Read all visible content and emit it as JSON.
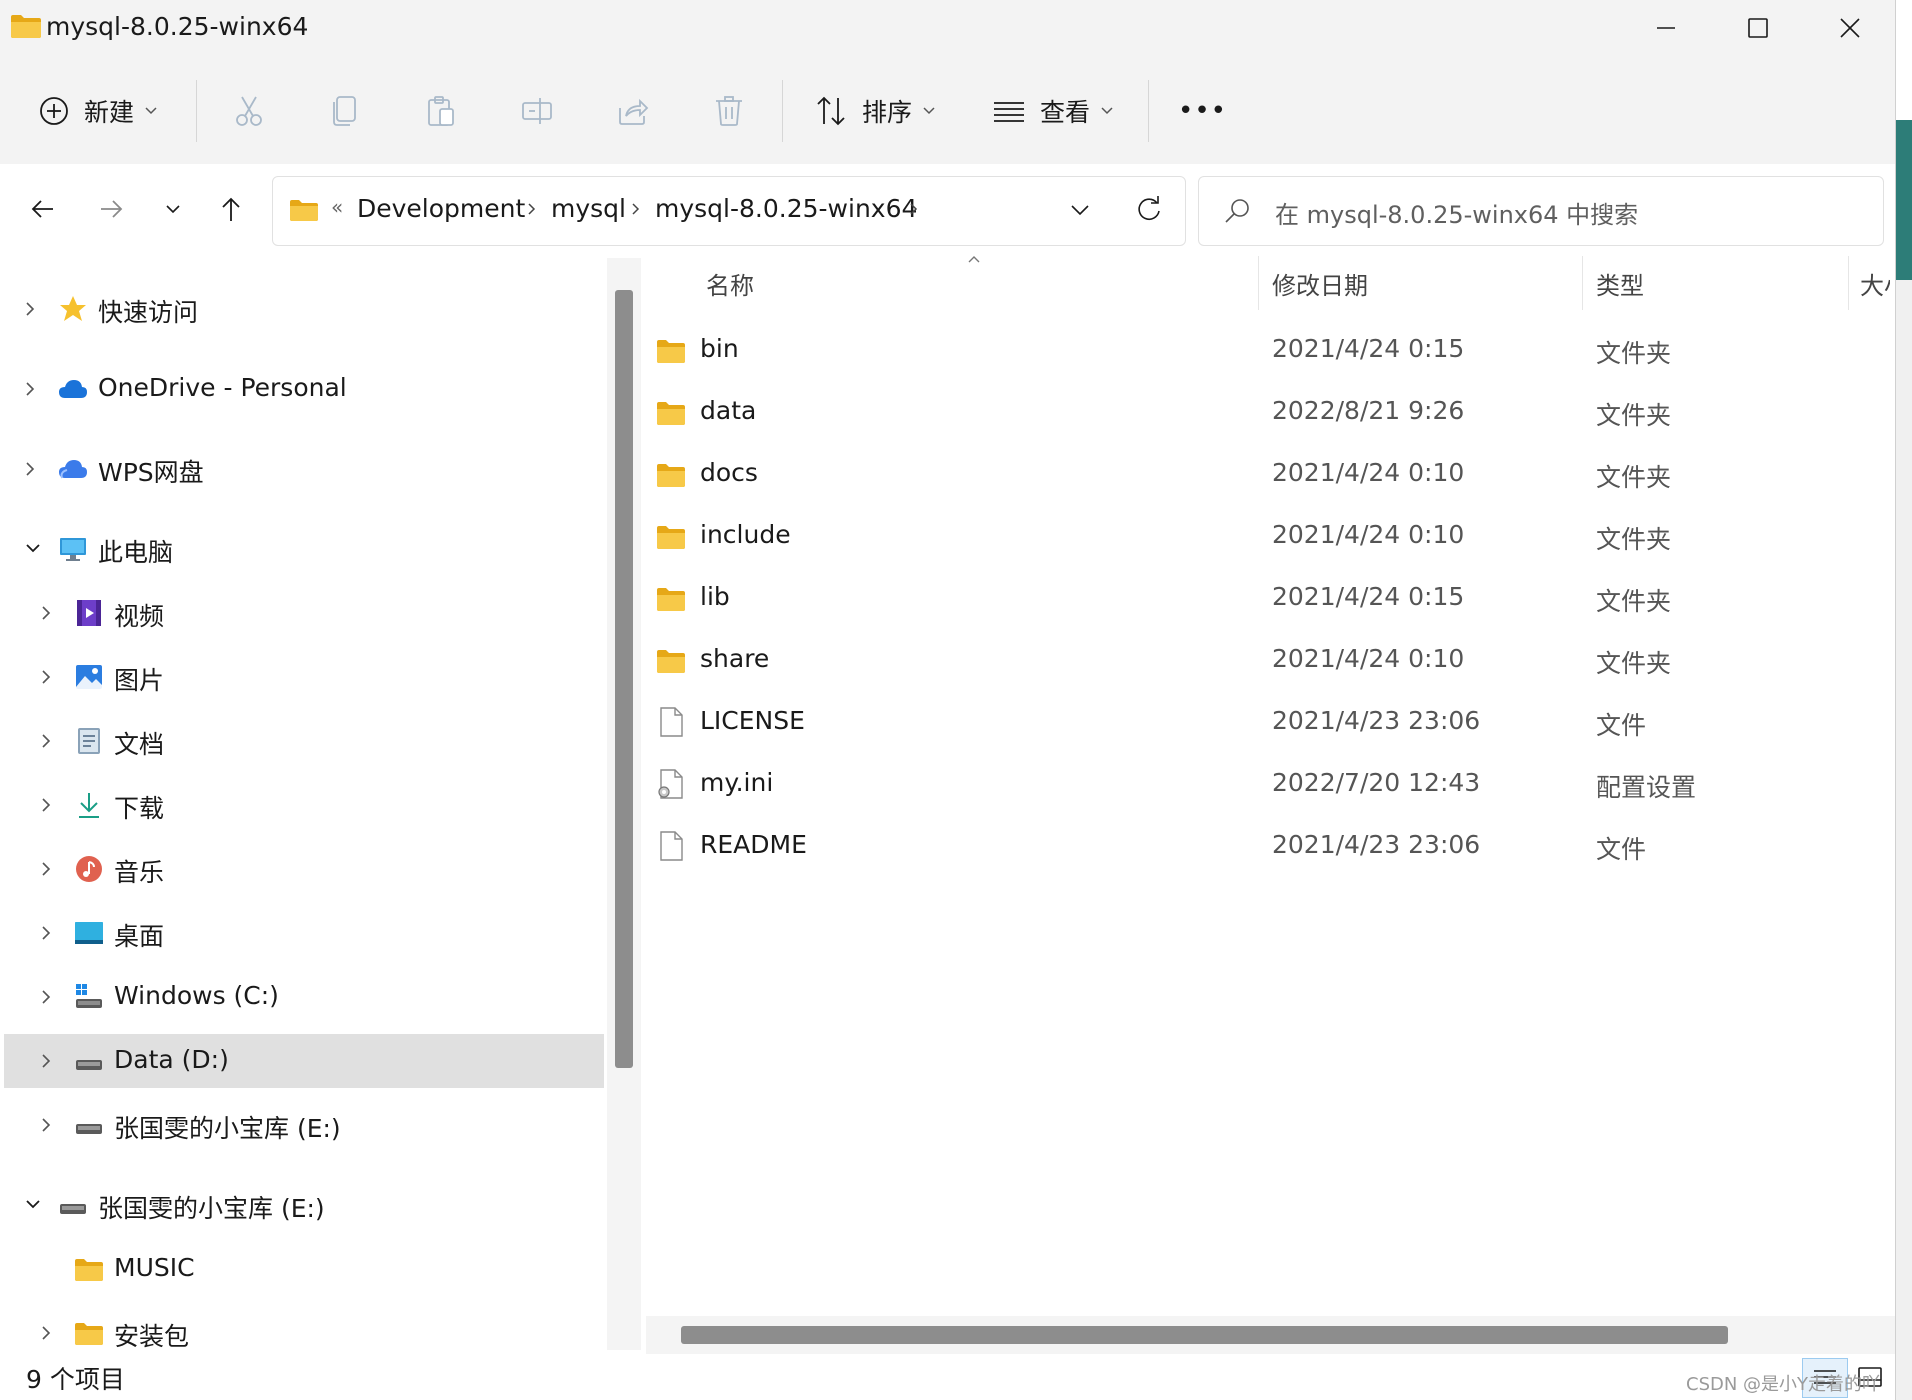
{
  "window": {
    "title": "mysql-8.0.25-winx64",
    "minimize_icon": "minimize-icon",
    "maximize_icon": "maximize-icon",
    "close_icon": "close-icon"
  },
  "toolbar": {
    "new_label": "新建",
    "sort_label": "排序",
    "view_label": "查看",
    "more_label": "•••",
    "icons": [
      "cut-icon",
      "copy-icon",
      "paste-icon",
      "rename-icon",
      "share-icon",
      "delete-icon"
    ]
  },
  "address": {
    "more": "«",
    "crumbs": [
      "Development",
      "mysql",
      "mysql-8.0.25-winx64"
    ],
    "search_placeholder": "在 mysql-8.0.25-winx64 中搜索"
  },
  "sidebar": {
    "items": [
      {
        "label": "快速访问",
        "icon": "star-icon"
      },
      {
        "label": "OneDrive - Personal",
        "icon": "cloud-icon"
      },
      {
        "label": "WPS网盘",
        "icon": "cloud-icon"
      },
      {
        "label": "此电脑",
        "icon": "computer-icon"
      },
      {
        "label": "视频",
        "icon": "video-icon"
      },
      {
        "label": "图片",
        "icon": "picture-icon"
      },
      {
        "label": "文档",
        "icon": "document-icon"
      },
      {
        "label": "下载",
        "icon": "download-icon"
      },
      {
        "label": "音乐",
        "icon": "music-icon"
      },
      {
        "label": "桌面",
        "icon": "desktop-icon"
      },
      {
        "label": "Windows (C:)",
        "icon": "drive-icon"
      },
      {
        "label": "Data (D:)",
        "icon": "drive-icon"
      },
      {
        "label": "张国雯的小宝库 (E:)",
        "icon": "drive-icon"
      },
      {
        "label": "张国雯的小宝库 (E:)",
        "icon": "drive-icon"
      },
      {
        "label": "MUSIC",
        "icon": "folder-icon"
      },
      {
        "label": "安装包",
        "icon": "folder-icon"
      }
    ]
  },
  "columns": {
    "name": "名称",
    "date": "修改日期",
    "type": "类型",
    "size": "大小"
  },
  "files": [
    {
      "name": "bin",
      "date": "2021/4/24 0:15",
      "type": "文件夹",
      "icon": "folder-icon"
    },
    {
      "name": "data",
      "date": "2022/8/21 9:26",
      "type": "文件夹",
      "icon": "folder-icon"
    },
    {
      "name": "docs",
      "date": "2021/4/24 0:10",
      "type": "文件夹",
      "icon": "folder-icon"
    },
    {
      "name": "include",
      "date": "2021/4/24 0:10",
      "type": "文件夹",
      "icon": "folder-icon"
    },
    {
      "name": "lib",
      "date": "2021/4/24 0:15",
      "type": "文件夹",
      "icon": "folder-icon"
    },
    {
      "name": "share",
      "date": "2021/4/24 0:10",
      "type": "文件夹",
      "icon": "folder-icon"
    },
    {
      "name": "LICENSE",
      "date": "2021/4/23 23:06",
      "type": "文件",
      "icon": "file-icon"
    },
    {
      "name": "my.ini",
      "date": "2022/7/20 12:43",
      "type": "配置设置",
      "icon": "config-file-icon"
    },
    {
      "name": "README",
      "date": "2021/4/23 23:06",
      "type": "文件",
      "icon": "file-icon"
    }
  ],
  "status": {
    "count": "9 个项目",
    "watermark": "CSDN @是小Y走着的吖"
  },
  "colors": {
    "folder": "#f7c948",
    "folder_dark": "#e6a817",
    "accent": "#0067c0",
    "selected": "#e0e0e0"
  }
}
